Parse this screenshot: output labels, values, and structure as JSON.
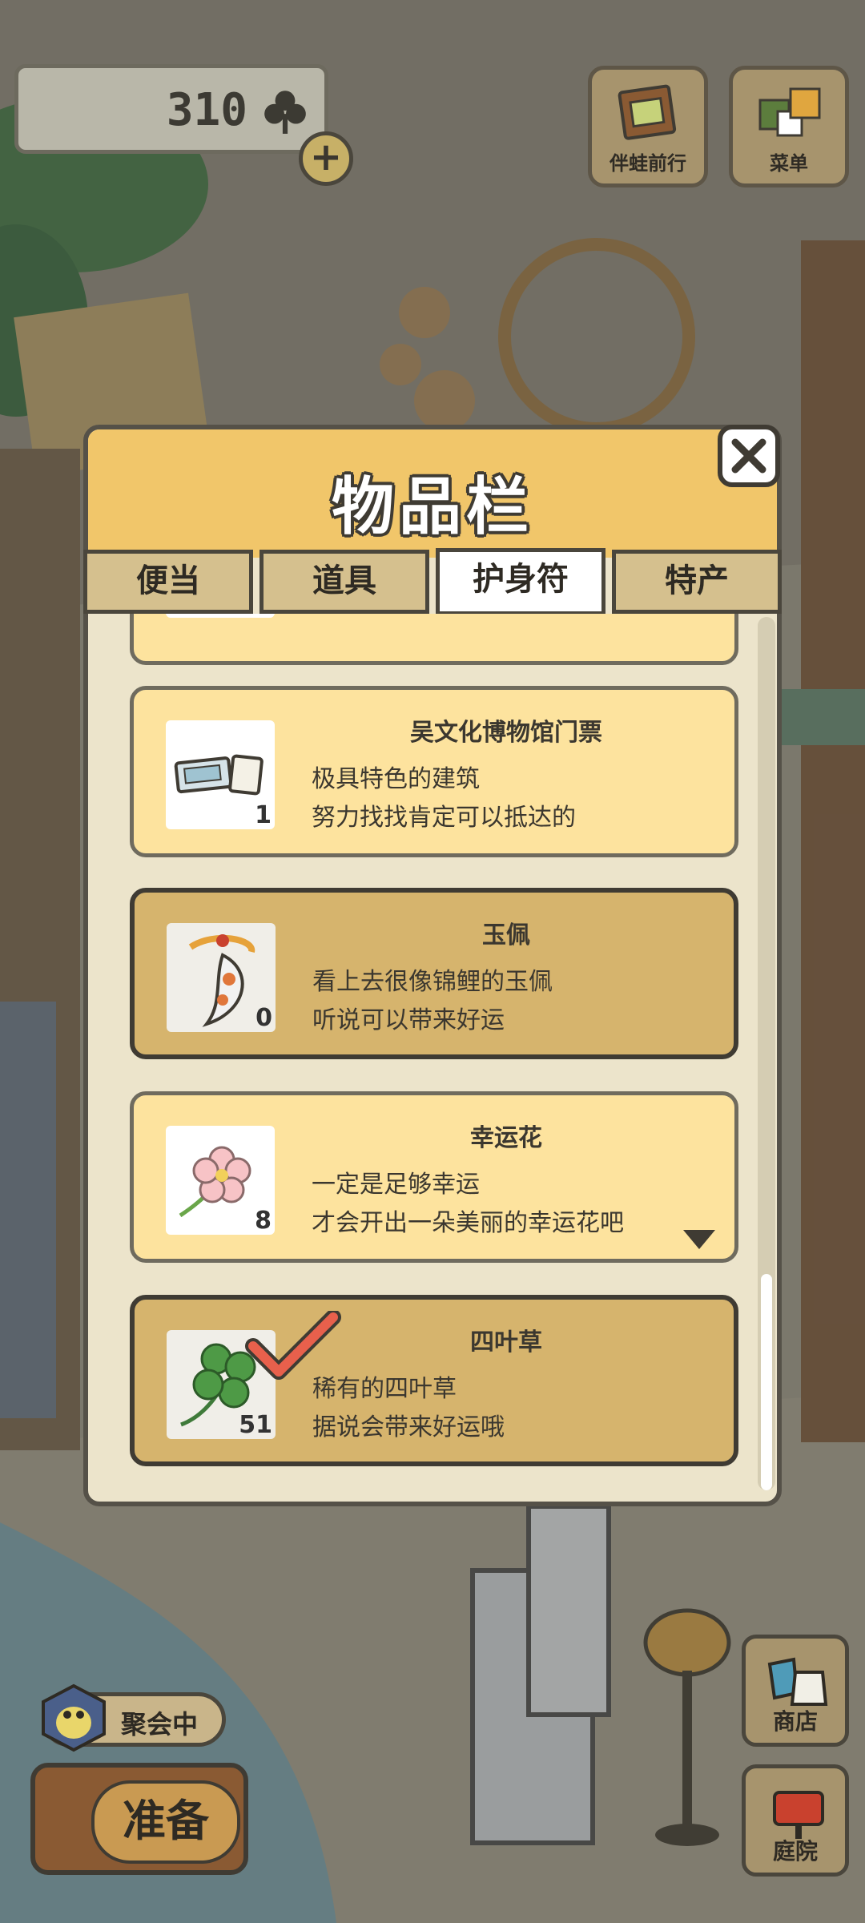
{
  "header": {
    "clover_count": "310",
    "clover_icon": "clover-icon",
    "add_icon": "plus-icon",
    "travel_button_label": "伴蛙前行",
    "menu_button_label": "菜单"
  },
  "inventory": {
    "title": "物品栏",
    "close_icon": "close-icon",
    "tabs": [
      {
        "label": "便当",
        "active": false
      },
      {
        "label": "道具",
        "active": false
      },
      {
        "label": "护身符",
        "active": true
      },
      {
        "label": "特产",
        "active": false
      }
    ],
    "items": [
      {
        "name": "吴文化博物馆门票",
        "line1": "极具特色的建筑",
        "line2": "努力找找肯定可以抵达的",
        "qty": "1",
        "icon": "ticket-icon",
        "selected": false
      },
      {
        "name": "玉佩",
        "line1": "看上去很像锦鲤的玉佩",
        "line2": "听说可以带来好运",
        "qty": "0",
        "icon": "koi-pendant-icon",
        "selected": false
      },
      {
        "name": "幸运花",
        "line1": "一定是足够幸运",
        "line2": "才会开出一朵美丽的幸运花吧",
        "qty": "8",
        "icon": "flower-icon",
        "selected": false
      },
      {
        "name": "四叶草",
        "line1": "稀有的四叶草",
        "line2": "据说会带来好运哦",
        "qty": "51",
        "icon": "four-leaf-clover-icon",
        "selected": true
      }
    ]
  },
  "bottom": {
    "party_label": "聚会中",
    "prepare_label": "准备",
    "shop_label": "商店",
    "yard_label": "庭院"
  },
  "colors": {
    "panel_header": "#f1c66a",
    "card_light": "#fde39e",
    "card_dark": "#d6b46d",
    "check_red": "#e8604c"
  }
}
